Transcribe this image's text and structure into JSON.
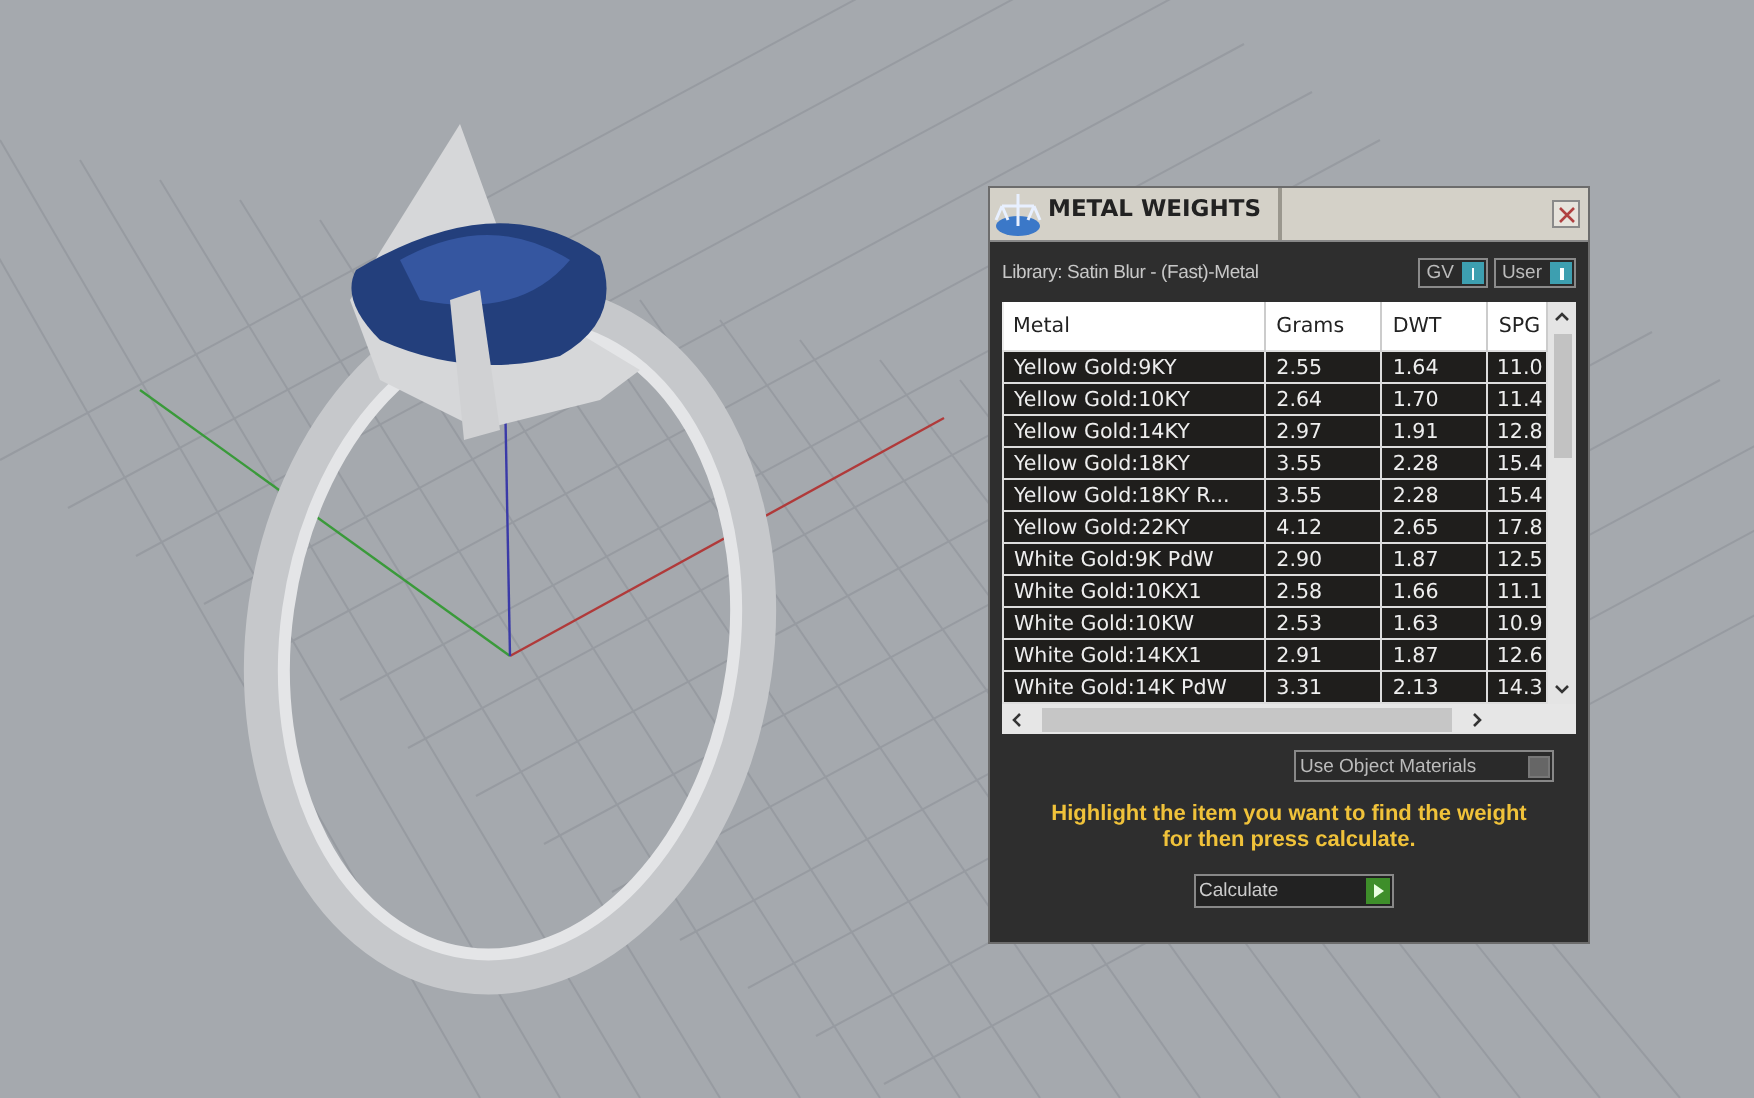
{
  "panel": {
    "title": "METAL WEIGHTS",
    "library": "Library: Satin Blur - (Fast)-Metal",
    "toggles": [
      {
        "label": "GV",
        "on": true
      },
      {
        "label": "User",
        "on": true
      }
    ],
    "table": {
      "columns": [
        "Metal",
        "Grams",
        "DWT",
        "SPG"
      ],
      "rows": [
        [
          "Yellow Gold:9KY",
          "2.55",
          "1.64",
          "11.0"
        ],
        [
          "Yellow Gold:10KY",
          "2.64",
          "1.70",
          "11.4"
        ],
        [
          "Yellow Gold:14KY",
          "2.97",
          "1.91",
          "12.8"
        ],
        [
          "Yellow Gold:18KY",
          "3.55",
          "2.28",
          "15.4"
        ],
        [
          "Yellow Gold:18KY R...",
          "3.55",
          "2.28",
          "15.4"
        ],
        [
          "Yellow Gold:22KY",
          "4.12",
          "2.65",
          "17.8"
        ],
        [
          "White Gold:9K PdW",
          "2.90",
          "1.87",
          "12.5"
        ],
        [
          "White Gold:10KX1",
          "2.58",
          "1.66",
          "11.1"
        ],
        [
          "White Gold:10KW",
          "2.53",
          "1.63",
          "10.9"
        ],
        [
          "White Gold:14KX1",
          "2.91",
          "1.87",
          "12.6"
        ],
        [
          "White Gold:14K PdW",
          "3.31",
          "2.13",
          "14.3"
        ]
      ]
    },
    "use_object_materials": {
      "label": "Use Object Materials",
      "on": false
    },
    "hint": "Highlight the item you want to find the weight for then press calculate.",
    "calculate_button": "Calculate"
  }
}
